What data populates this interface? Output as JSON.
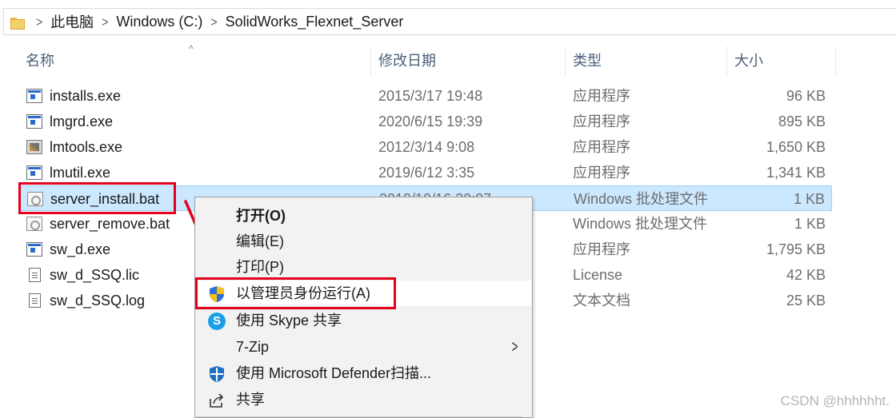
{
  "breadcrumb": {
    "items": [
      "此电脑",
      "Windows (C:)",
      "SolidWorks_Flexnet_Server"
    ]
  },
  "columns": {
    "name": "名称",
    "date": "修改日期",
    "type": "类型",
    "size": "大小"
  },
  "files": [
    {
      "name": "installs.exe",
      "date": "2015/3/17 19:48",
      "type": "应用程序",
      "size": "96 KB",
      "icon": "exe-icon"
    },
    {
      "name": "lmgrd.exe",
      "date": "2020/6/15 19:39",
      "type": "应用程序",
      "size": "895 KB",
      "icon": "exe-icon"
    },
    {
      "name": "lmtools.exe",
      "date": "2012/3/14 9:08",
      "type": "应用程序",
      "size": "1,650 KB",
      "icon": "tools-icon"
    },
    {
      "name": "lmutil.exe",
      "date": "2019/6/12 3:35",
      "type": "应用程序",
      "size": "1,341 KB",
      "icon": "exe-icon"
    },
    {
      "name": "server_install.bat",
      "date": "2019/10/16 20:07",
      "type": "Windows 批处理文件",
      "size": "1 KB",
      "icon": "batch-file-icon",
      "selected": true
    },
    {
      "name": "server_remove.bat",
      "date": "",
      "type": "Windows 批处理文件",
      "size": "1 KB",
      "icon": "batch-file-icon"
    },
    {
      "name": "sw_d.exe",
      "date": "",
      "type": "应用程序",
      "size": "1,795 KB",
      "icon": "exe-icon"
    },
    {
      "name": "sw_d_SSQ.lic",
      "date": "",
      "type": "License",
      "size": "42 KB",
      "icon": "license-file-icon"
    },
    {
      "name": "sw_d_SSQ.log",
      "date": "",
      "type": "文本文档",
      "size": "25 KB",
      "icon": "text-file-icon"
    }
  ],
  "context_menu": {
    "items": [
      {
        "label": "打开(O)",
        "icon": "",
        "bold": true
      },
      {
        "label": "编辑(E)",
        "icon": ""
      },
      {
        "label": "打印(P)",
        "icon": ""
      },
      {
        "label": "以管理员身份运行(A)",
        "icon": "uac-shield-icon",
        "highlighted": true
      },
      {
        "label": "使用 Skype 共享",
        "icon": "skype-icon"
      },
      {
        "label": "7-Zip",
        "icon": "",
        "submenu": true
      },
      {
        "label": "使用 Microsoft Defender扫描...",
        "icon": "defender-icon"
      },
      {
        "label": "共享",
        "icon": "share-icon"
      }
    ]
  },
  "colors": {
    "selection_bg": "#cce8ff",
    "annotation_red": "#e3001b",
    "menu_bg": "#f2f2f2"
  },
  "watermark": "CSDN @hhhhhht."
}
